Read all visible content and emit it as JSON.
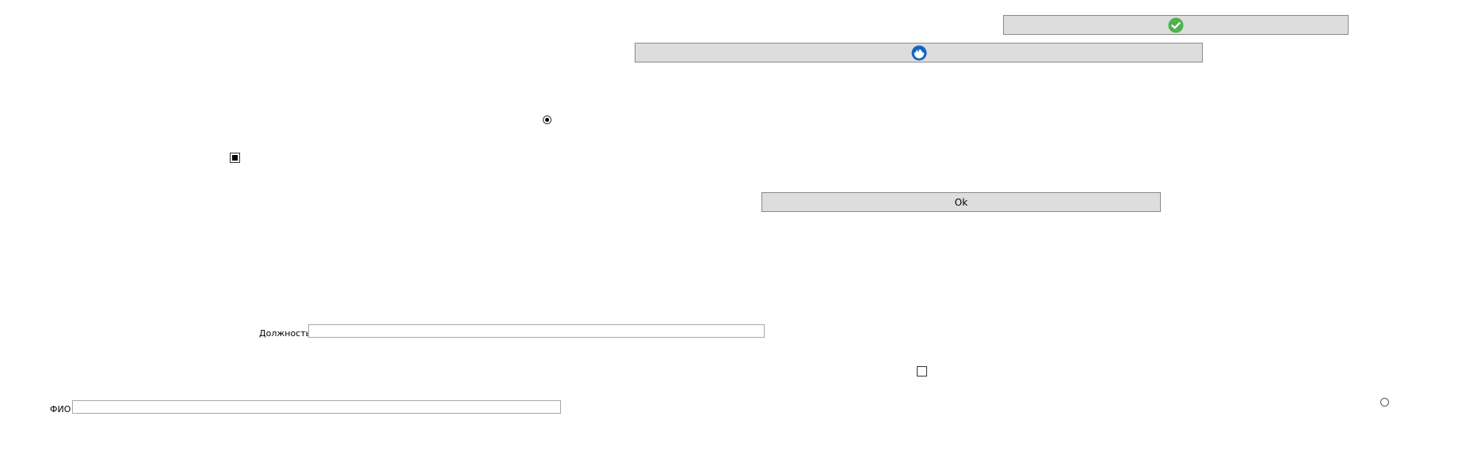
{
  "buttons": {
    "confirm": {
      "icon": "check-circle-icon",
      "icon_color": "#4db34d"
    },
    "sync": {
      "icon": "refresh-icon",
      "icon_color": "#1565c0"
    },
    "ok": {
      "label": "Ok"
    }
  },
  "radios": {
    "top": {
      "checked": true
    },
    "right": {
      "checked": false
    }
  },
  "checkboxes": {
    "top": {
      "checked": true
    },
    "middle": {
      "checked": false
    }
  },
  "fields": {
    "position": {
      "label": "Должность",
      "value": ""
    },
    "full_name": {
      "label": "ФИО",
      "value": ""
    }
  }
}
